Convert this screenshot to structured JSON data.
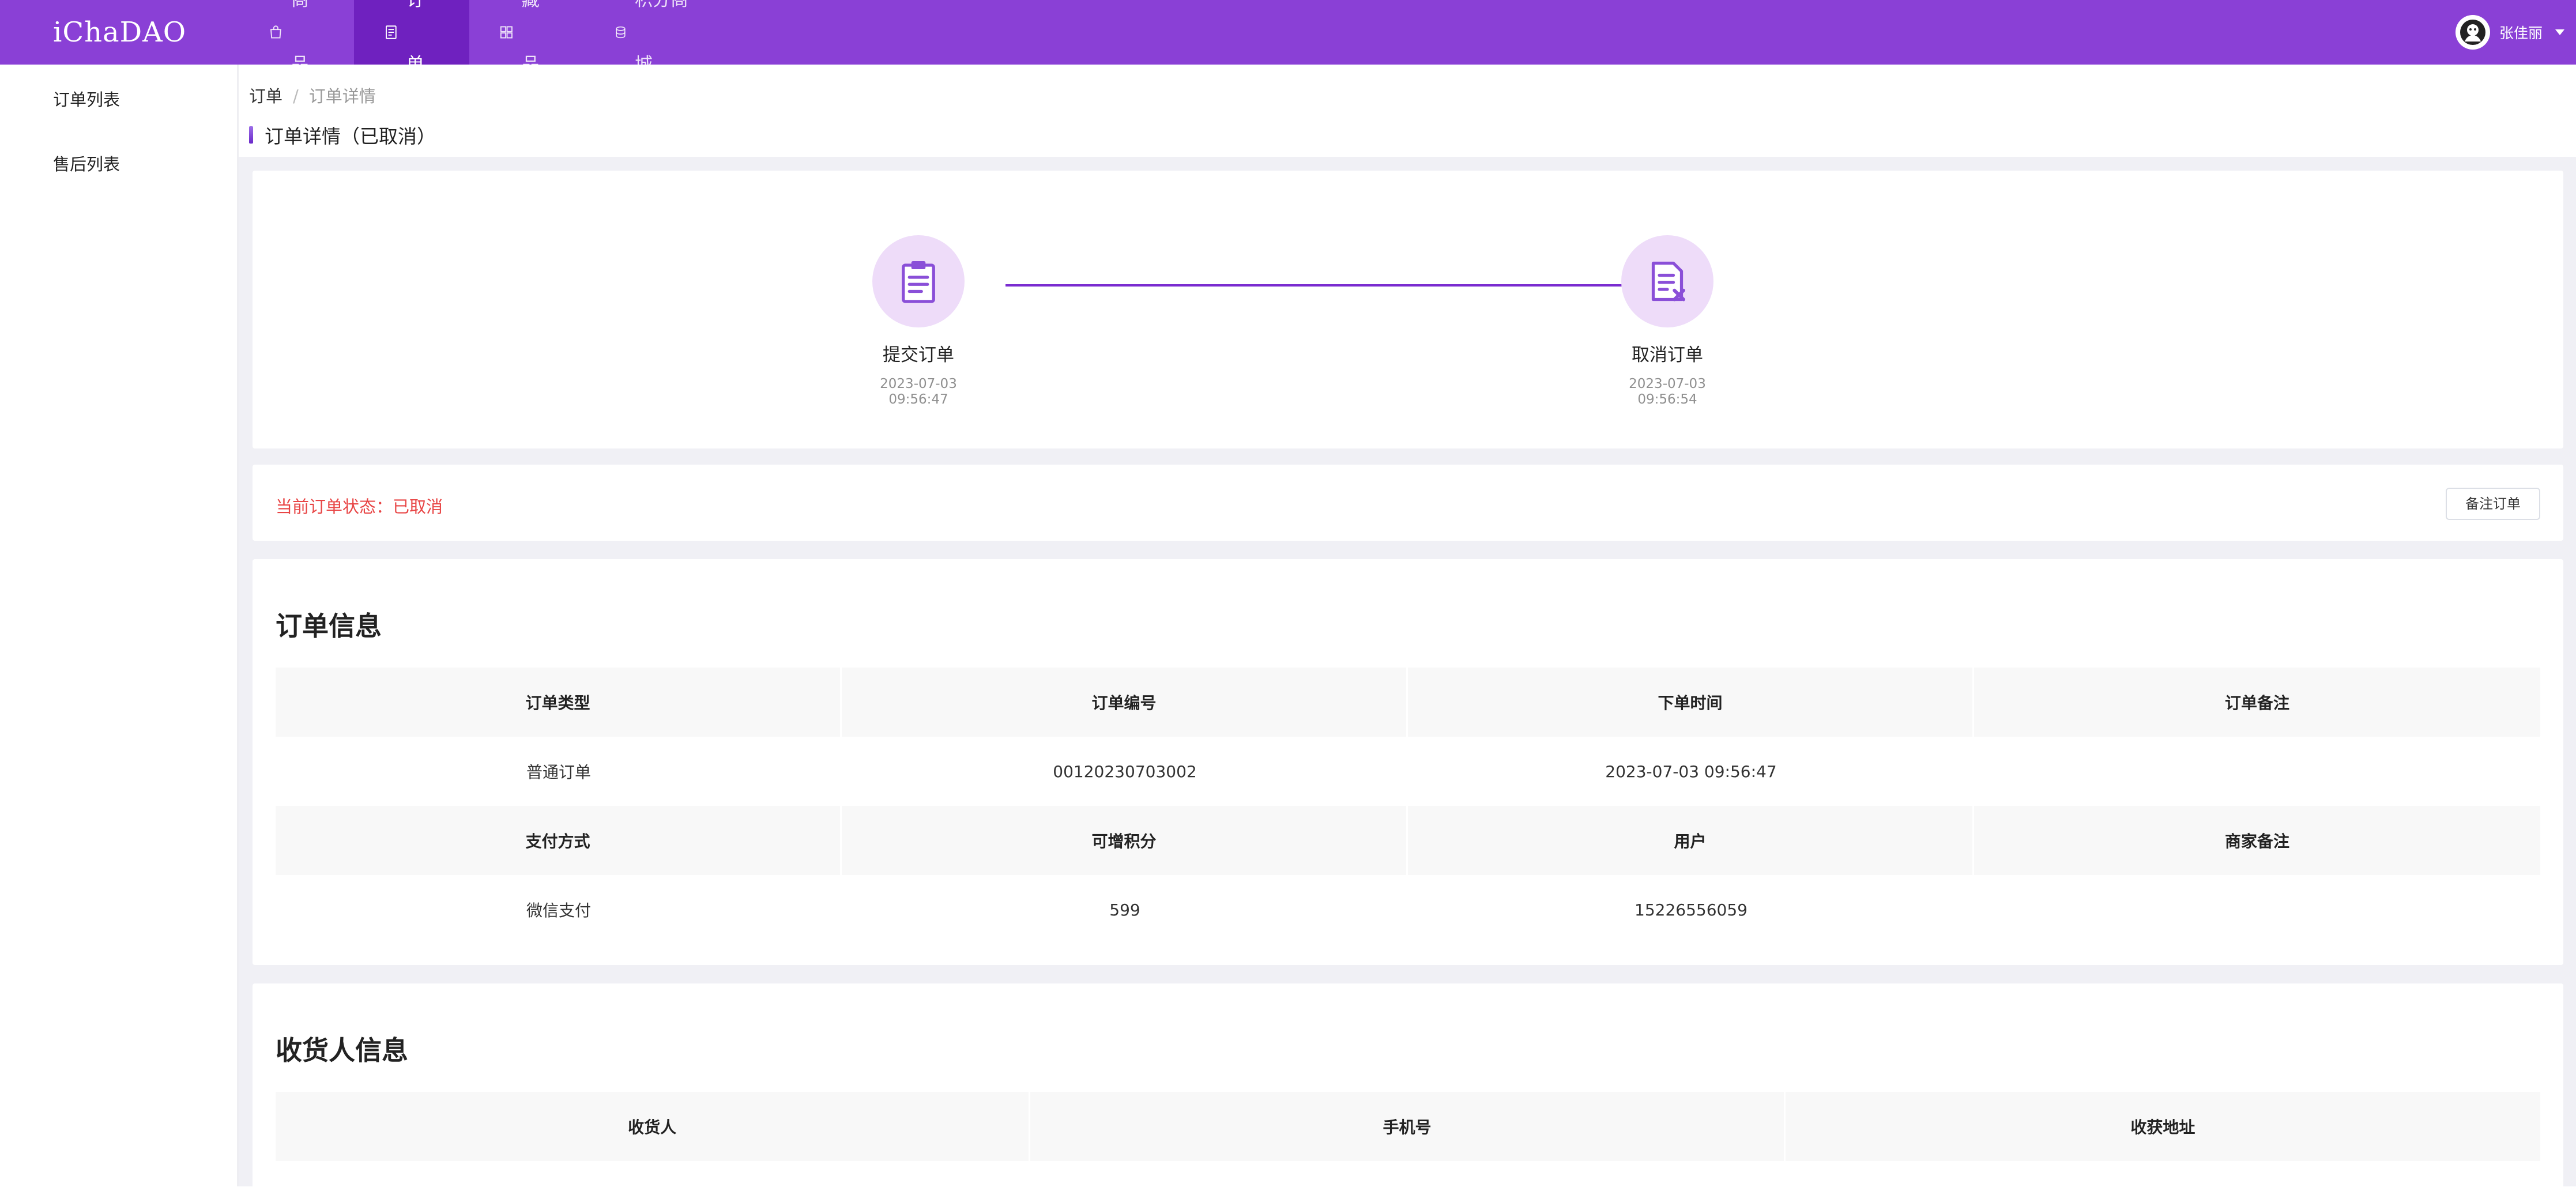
{
  "app": {
    "logo": "iChaDAO"
  },
  "nav": {
    "items": [
      {
        "label": "商品",
        "icon": "bag-icon"
      },
      {
        "label": "订单",
        "icon": "document-icon",
        "active": true
      },
      {
        "label": "藏品",
        "icon": "grid-icon"
      },
      {
        "label": "积分商城",
        "icon": "coins-icon"
      }
    ],
    "user_name": "张佳丽"
  },
  "sidebar": {
    "items": [
      {
        "label": "订单列表"
      },
      {
        "label": "售后列表"
      }
    ]
  },
  "breadcrumb": {
    "root": "订单",
    "separator": "/",
    "current": "订单详情"
  },
  "page": {
    "title": "订单详情（已取消）"
  },
  "progress": {
    "steps": [
      {
        "label": "提交订单",
        "date": "2023-07-03",
        "time": "09:56:47",
        "icon": "clipboard-icon"
      },
      {
        "label": "取消订单",
        "date": "2023-07-03",
        "time": "09:56:54",
        "icon": "cancel-document-icon"
      }
    ]
  },
  "status": {
    "text": "当前订单状态：已取消",
    "remark_button": "备注订单"
  },
  "order_info": {
    "title": "订单信息",
    "row1_headers": [
      "订单类型",
      "订单编号",
      "下单时间",
      "订单备注"
    ],
    "row1_values": [
      "普通订单",
      "00120230703002",
      "2023-07-03 09:56:47",
      ""
    ],
    "row2_headers": [
      "支付方式",
      "可增积分",
      "用户",
      "商家备注"
    ],
    "row2_values": [
      "微信支付",
      "599",
      "15226556059",
      ""
    ]
  },
  "receiver_info": {
    "title": "收货人信息",
    "headers": [
      "收货人",
      "手机号",
      "收获地址"
    ]
  },
  "colors": {
    "brand": "#8a40d6",
    "brand_active": "#6f21bf",
    "status_red": "#e84545"
  }
}
